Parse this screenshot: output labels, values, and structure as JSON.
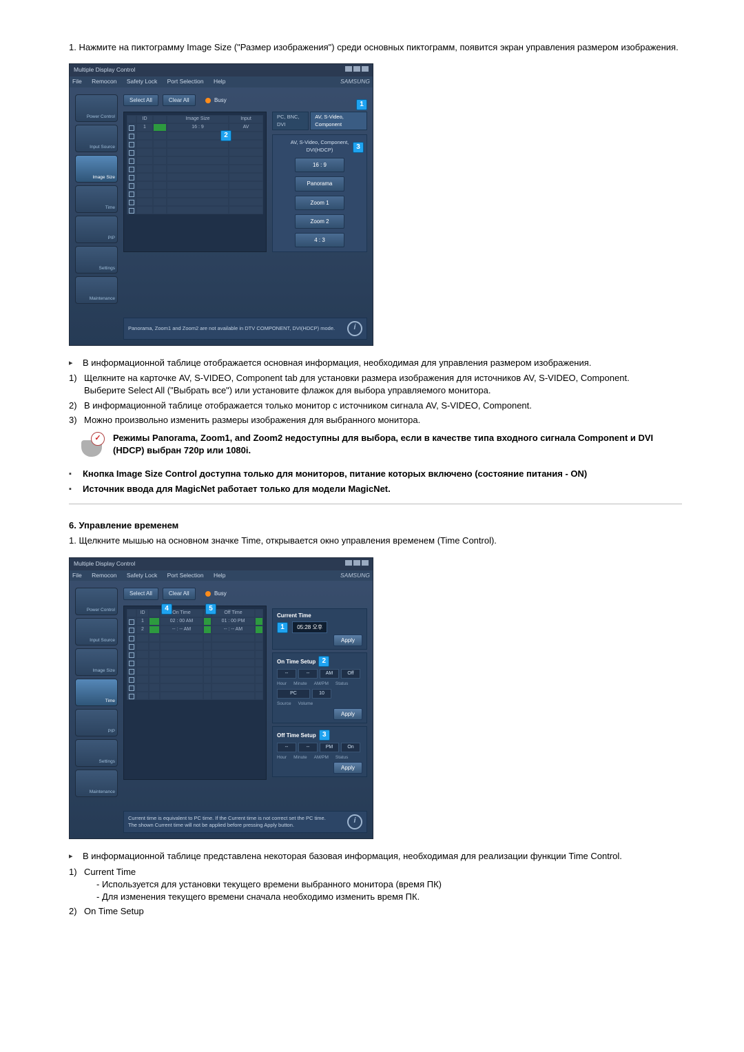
{
  "intro": {
    "num": "1.",
    "text": "Нажмите на пиктограмму Image Size (\"Размер изображения\") среди основных пиктограмм, появится экран управления размером изображения."
  },
  "shot1": {
    "title": "Multiple Display Control",
    "menus": [
      "File",
      "Remocon",
      "Safety Lock",
      "Port Selection",
      "Help"
    ],
    "brand": "SAMSUNG",
    "sidebar": [
      "Power Control",
      "Input Source",
      "Image Size",
      "Time",
      "PIP",
      "Settings",
      "Maintenance"
    ],
    "sidebar_active": 2,
    "toolbar": {
      "select_all": "Select All",
      "clear_all": "Clear All",
      "busy": "Busy"
    },
    "thead": [
      "ID",
      "",
      "Image Size",
      "Input"
    ],
    "row_name": "16 : 9",
    "row_input": "AV",
    "tabs": [
      "PC, BNC, DVI",
      "AV, S-Video, Component"
    ],
    "tabs_active": 1,
    "sub_header": "AV, S-Video, Component, DVI(HDCP)",
    "options": [
      "16 : 9",
      "Panorama",
      "Zoom 1",
      "Zoom 2",
      "4 : 3"
    ],
    "footer": "Panorama, Zoom1 and Zoom2 are not available in DTV COMPONENT, DVI(HDCP) mode."
  },
  "bullets_after_shot1": {
    "main": "В информационной таблице отображается основная информация, необходимая для управления размером изображения.",
    "n1a": "Щелкните на карточке AV, S-VIDEO, Component tab для установки размера изображения для источников AV, S-VIDEO, Component.",
    "n1b": "Выберите Select All (\"Выбрать все\") или установите флажок для выбора управляемого монитора.",
    "n2": "В информационной таблице отображается только монитор с источником сигнала AV, S-VIDEO, Component.",
    "n3": "Можно произвольно изменить размеры изображения для выбранного монитора."
  },
  "note1": "Режимы Panorama, Zoom1, and Zoom2 недоступны для выбора, если в качестве типа входного сигнала Component и DVI (HDCP) выбран 720p или 1080i.",
  "note2a": "Кнопка Image Size Control доступна только для мониторов, питание которых включено (состояние питания - ON)",
  "note2b": "Источник ввода для MagicNet работает только для модели MagicNet.",
  "section6": {
    "heading": "6. Управление временем",
    "line1num": "1.",
    "line1": "Щелкните мышью на основном значке Time, открывается окно управления временем (Time Control)."
  },
  "shot2": {
    "title": "Multiple Display Control",
    "menus": [
      "File",
      "Remocon",
      "Safety Lock",
      "Port Selection",
      "Help"
    ],
    "brand": "SAMSUNG",
    "sidebar": [
      "Power Control",
      "Input Source",
      "Image Size",
      "Time",
      "PIP",
      "Settings",
      "Maintenance"
    ],
    "sidebar_active": 3,
    "toolbar": {
      "select_all": "Select All",
      "clear_all": "Clear All",
      "busy": "Busy"
    },
    "thead": [
      "ID",
      "",
      "On Time",
      "",
      "Off Time",
      ""
    ],
    "rows": [
      {
        "on": "02 : 00  AM",
        "off": "01 : 00  PM"
      },
      {
        "on": "-- : --   AM",
        "off": "-- : --   AM"
      }
    ],
    "cur_time_label": "Current Time",
    "cur_time_value": "05:28 오후",
    "on_time_label": "On Time Setup",
    "off_time_label": "Off Time Setup",
    "apply": "Apply",
    "on_row_labels": [
      "Hour",
      "Minute",
      "AM/PM",
      "Status"
    ],
    "on_row2_labels": [
      "Source",
      "Volume"
    ],
    "selects": {
      "dash": "--",
      "am": "AM",
      "pm": "PM",
      "on": "On",
      "off": "Off",
      "pc": "PC",
      "vol": "10"
    },
    "footer1": "Current time is equivalent to PC time. If the Current time is not correct set the PC time.",
    "footer2": "The shown Current time will not be applied before pressing Apply button."
  },
  "bullets_after_shot2": {
    "main": "В информационной таблице представлена некоторая базовая информация, необходимая для реализации функции Time Control.",
    "n1": "Current Time",
    "n1a": "- Используется для установки текущего времени выбранного монитора (время ПК)",
    "n1b": "- Для изменения текущего времени сначала необходимо изменить время ПК.",
    "n2": "On Time Setup"
  }
}
